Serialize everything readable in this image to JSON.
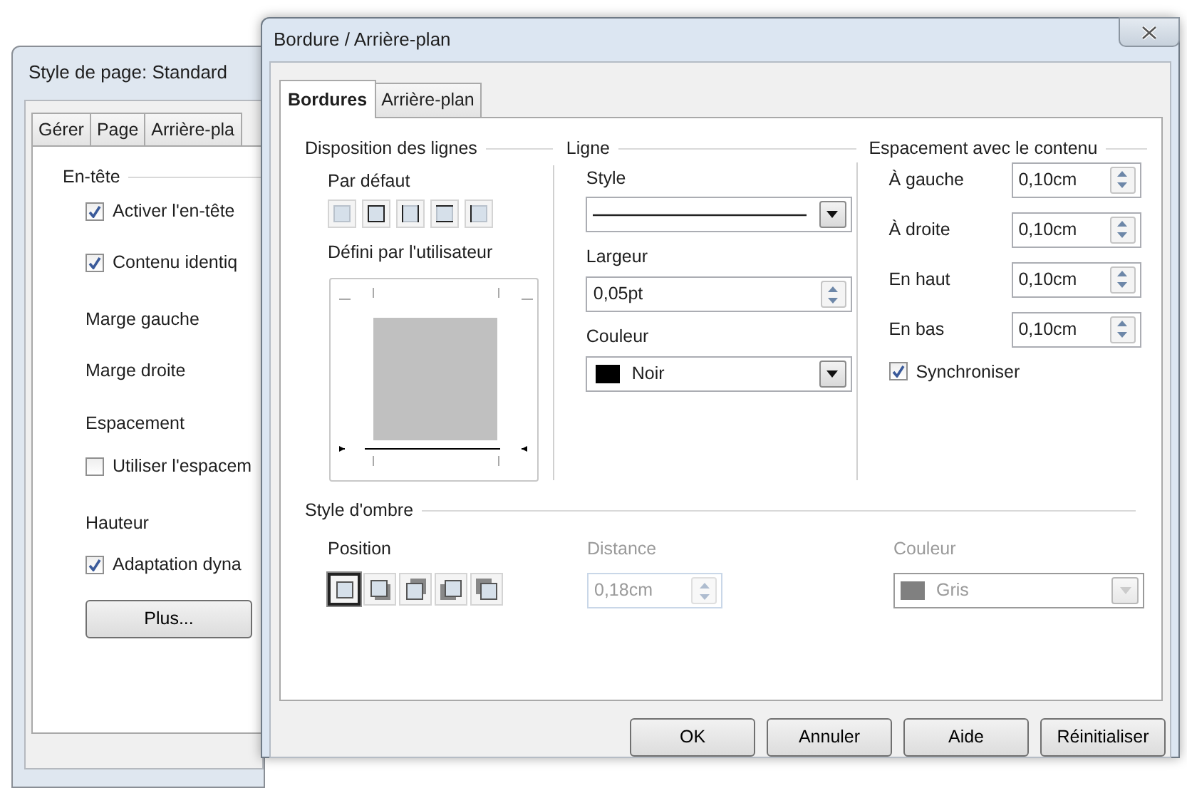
{
  "background_window": {
    "title": "Style de page: Standard",
    "tabs": [
      {
        "label": "Gérer",
        "selected": false
      },
      {
        "label": "Page",
        "selected": false
      },
      {
        "label": "Arrière-pla",
        "selected": false
      }
    ],
    "group_title": "En-tête",
    "items": [
      {
        "kind": "checkbox",
        "label": "Activer l'en-tête",
        "checked": true
      },
      {
        "kind": "checkbox",
        "label": "Contenu identiq",
        "checked": true
      },
      {
        "kind": "label",
        "label": "Marge gauche"
      },
      {
        "kind": "label",
        "label": "Marge droite"
      },
      {
        "kind": "label",
        "label": "Espacement"
      },
      {
        "kind": "checkbox",
        "label": "Utiliser l'espacem",
        "checked": false
      },
      {
        "kind": "label",
        "label": "Hauteur"
      },
      {
        "kind": "checkbox",
        "label": "Adaptation dyna",
        "checked": true
      }
    ],
    "button": "Plus..."
  },
  "dialog": {
    "title": "Bordure / Arrière-plan",
    "tabs": [
      {
        "label": "Bordures",
        "selected": true
      },
      {
        "label": "Arrière-plan",
        "selected": false
      }
    ],
    "line_layout": {
      "title": "Disposition des lignes",
      "default_label": "Par défaut",
      "presets": [
        {
          "kind": "none",
          "selected": false
        },
        {
          "kind": "box",
          "selected": false
        },
        {
          "kind": "left-right",
          "selected": false
        },
        {
          "kind": "top-bottom",
          "selected": false
        },
        {
          "kind": "left",
          "selected": false
        }
      ],
      "user_label": "Défini par l'utilisateur"
    },
    "line": {
      "title": "Ligne",
      "style_label": "Style",
      "width_label": "Largeur",
      "width_value": "0,05pt",
      "color_label": "Couleur",
      "color_name": "Noir",
      "color": "#000000"
    },
    "spacing": {
      "title": "Espacement avec le contenu",
      "fields": [
        {
          "label": "À gauche",
          "value": "0,10cm"
        },
        {
          "label": "À droite",
          "value": "0,10cm"
        },
        {
          "label": "En haut",
          "value": "0,10cm"
        },
        {
          "label": "En bas",
          "value": "0,10cm"
        }
      ],
      "synchronize": {
        "label": "Synchroniser",
        "checked": true
      }
    },
    "shadow": {
      "title": "Style d'ombre",
      "position_label": "Position",
      "positions": [
        {
          "kind": "none",
          "selected": true
        },
        {
          "kind": "bottom-right",
          "selected": false
        },
        {
          "kind": "top-right",
          "selected": false
        },
        {
          "kind": "bottom-left",
          "selected": false
        },
        {
          "kind": "top-left",
          "selected": false
        }
      ],
      "distance": {
        "label": "Distance",
        "value": "0,18cm",
        "disabled": true
      },
      "color": {
        "label": "Couleur",
        "name": "Gris",
        "color": "#808080",
        "disabled": true
      }
    },
    "buttons": [
      "OK",
      "Annuler",
      "Aide",
      "Réinitialiser"
    ]
  }
}
